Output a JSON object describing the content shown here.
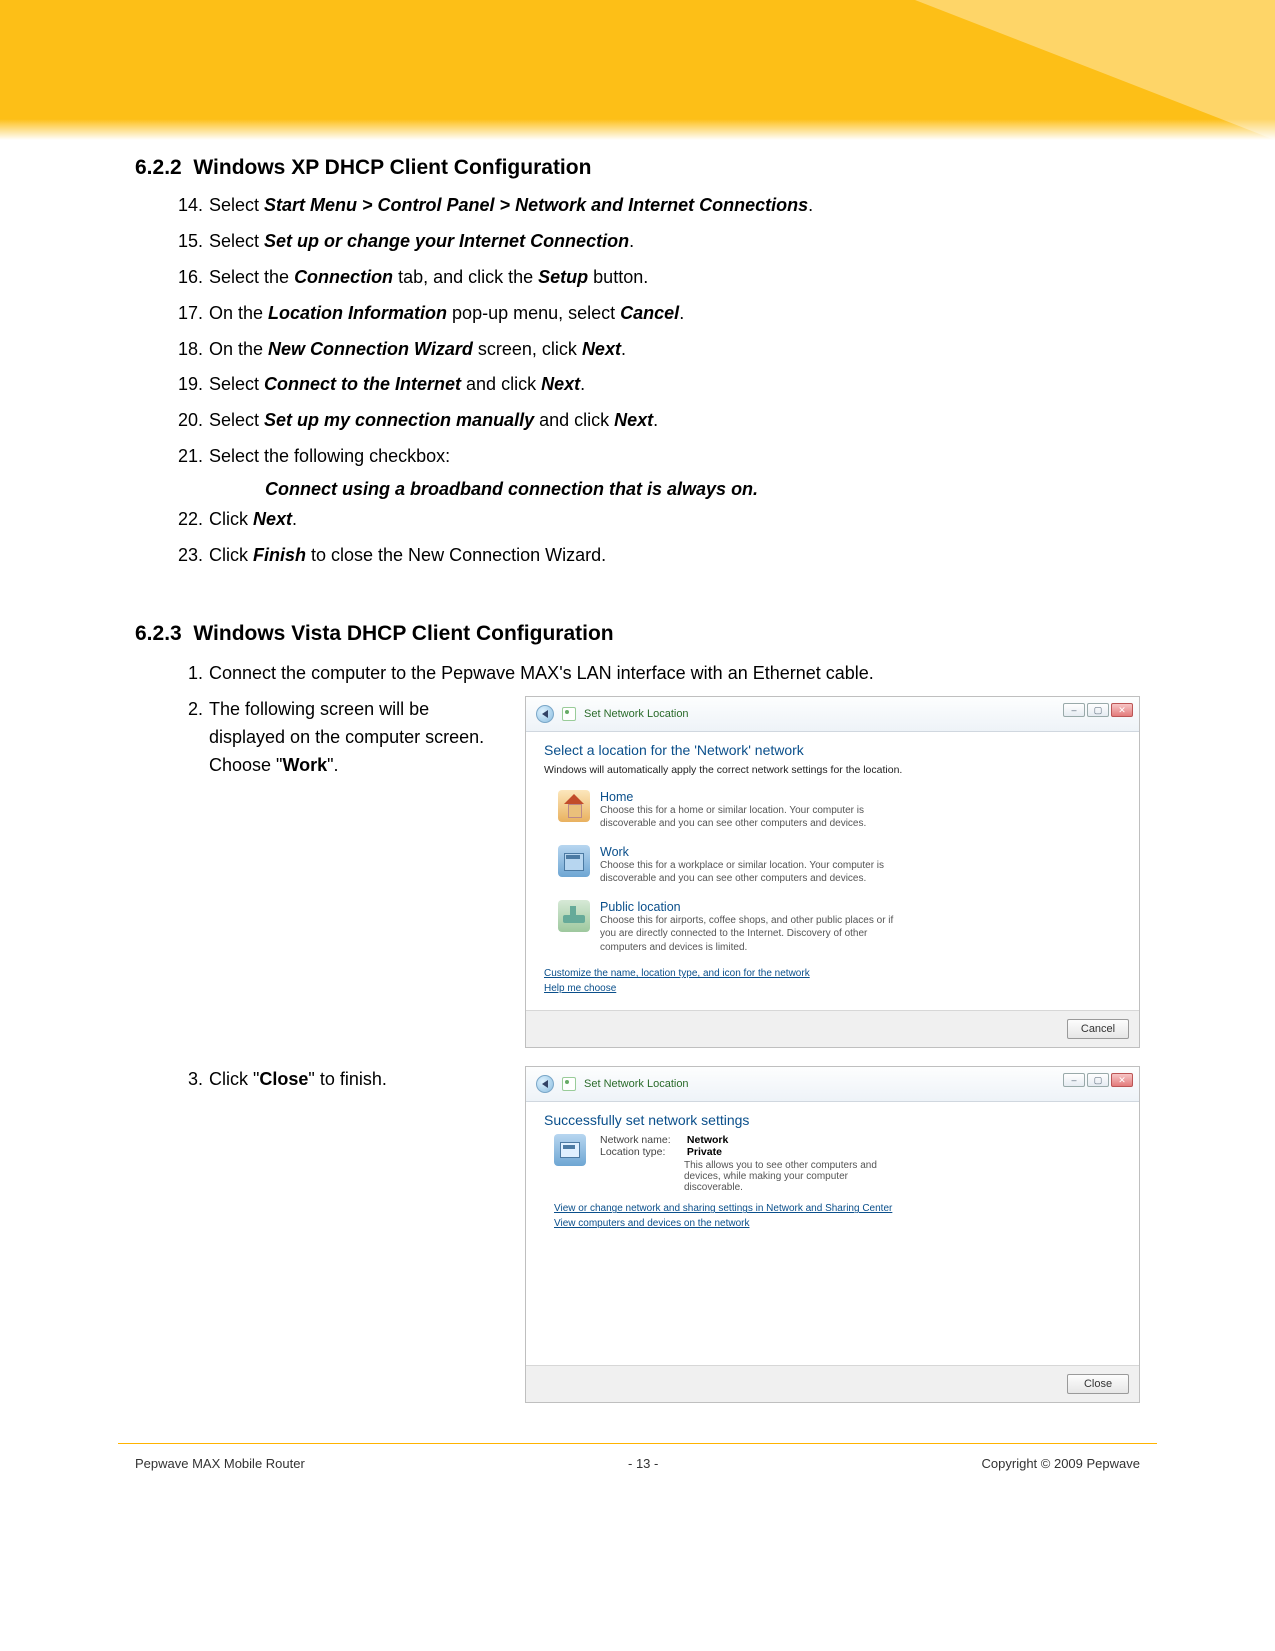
{
  "sectionXP": {
    "number": "6.2.2",
    "title": "Windows XP DHCP Client Configuration",
    "steps": [
      {
        "n": "14",
        "pre": "Select ",
        "bold": "Start Menu > Control Panel > Network and Internet Connections",
        "post": "."
      },
      {
        "n": "15",
        "pre": "Select ",
        "bold": "Set up or change your Internet Connection",
        "post": "."
      },
      {
        "n": "16",
        "pre": "Select the ",
        "bold": "Connection",
        "mid": " tab, and click the ",
        "bold2": "Setup",
        "post": " button."
      },
      {
        "n": "17",
        "pre": "On the ",
        "bold": "Location Information",
        "mid": " pop-up menu, select ",
        "bold2": "Cancel",
        "post": "."
      },
      {
        "n": "18",
        "pre": "On the ",
        "bold": "New Connection Wizard",
        "mid": " screen, click ",
        "bold2": "Next",
        "post": "."
      },
      {
        "n": "19",
        "pre": "Select ",
        "bold": "Connect to the Internet",
        "mid": " and click ",
        "bold2": "Next",
        "post": "."
      },
      {
        "n": "20",
        "pre": "Select ",
        "bold": "Set up my connection manually",
        "mid": " and click ",
        "bold2": "Next",
        "post": "."
      },
      {
        "n": "21",
        "pre": "Select the following checkbox:",
        "bold": "",
        "post": ""
      }
    ],
    "checkboxLine": "Connect using a broadband connection that is always on.",
    "steps2": [
      {
        "n": "22",
        "pre": "Click ",
        "bold": "Next",
        "post": "."
      },
      {
        "n": "23",
        "pre": "Click ",
        "bold": "Finish",
        "mid": " to close the New Connection Wizard.",
        "post": ""
      }
    ]
  },
  "sectionVista": {
    "number": "6.2.3",
    "title": "Windows Vista DHCP Client Configuration",
    "step1": {
      "n": "1",
      "text": "Connect the computer to the Pepwave MAX's LAN interface with an Ethernet cable."
    },
    "step2": {
      "n": "2",
      "pre": "The following screen will be displayed on the computer screen.  Choose \"",
      "bold": "Work",
      "post": "\"."
    },
    "step3": {
      "n": "3",
      "pre": "Click \"",
      "bold": "Close",
      "post": "\" to finish."
    }
  },
  "fig1": {
    "title": "Set Network Location",
    "heading": "Select a location for the 'Network' network",
    "sub": "Windows will automatically apply the correct network settings for the location.",
    "opts": [
      {
        "title": "Home",
        "desc": "Choose this for a home or similar location. Your computer is discoverable and you can see other computers and devices."
      },
      {
        "title": "Work",
        "desc": "Choose this for a workplace or similar location. Your computer is discoverable and you can see other computers and devices."
      },
      {
        "title": "Public location",
        "desc": "Choose this for airports, coffee shops, and other public places or if you are directly connected to the Internet. Discovery of other computers and devices is limited."
      }
    ],
    "link1": "Customize the name, location type, and icon for the network",
    "link2": "Help me choose",
    "cancel": "Cancel"
  },
  "fig2": {
    "title": "Set Network Location",
    "heading": "Successfully set network settings",
    "netLabel": "Network name:",
    "netVal": "Network",
    "locLabel": "Location type:",
    "locVal": "Private",
    "desc": "This allows you to see other computers and devices, while making your computer discoverable.",
    "link1": "View or change network and sharing settings in Network and Sharing Center",
    "link2": "View computers and devices on the network",
    "close": "Close"
  },
  "footer": {
    "left": "Pepwave MAX Mobile Router",
    "center": "- 13 -",
    "right": "Copyright © 2009 Pepwave"
  }
}
